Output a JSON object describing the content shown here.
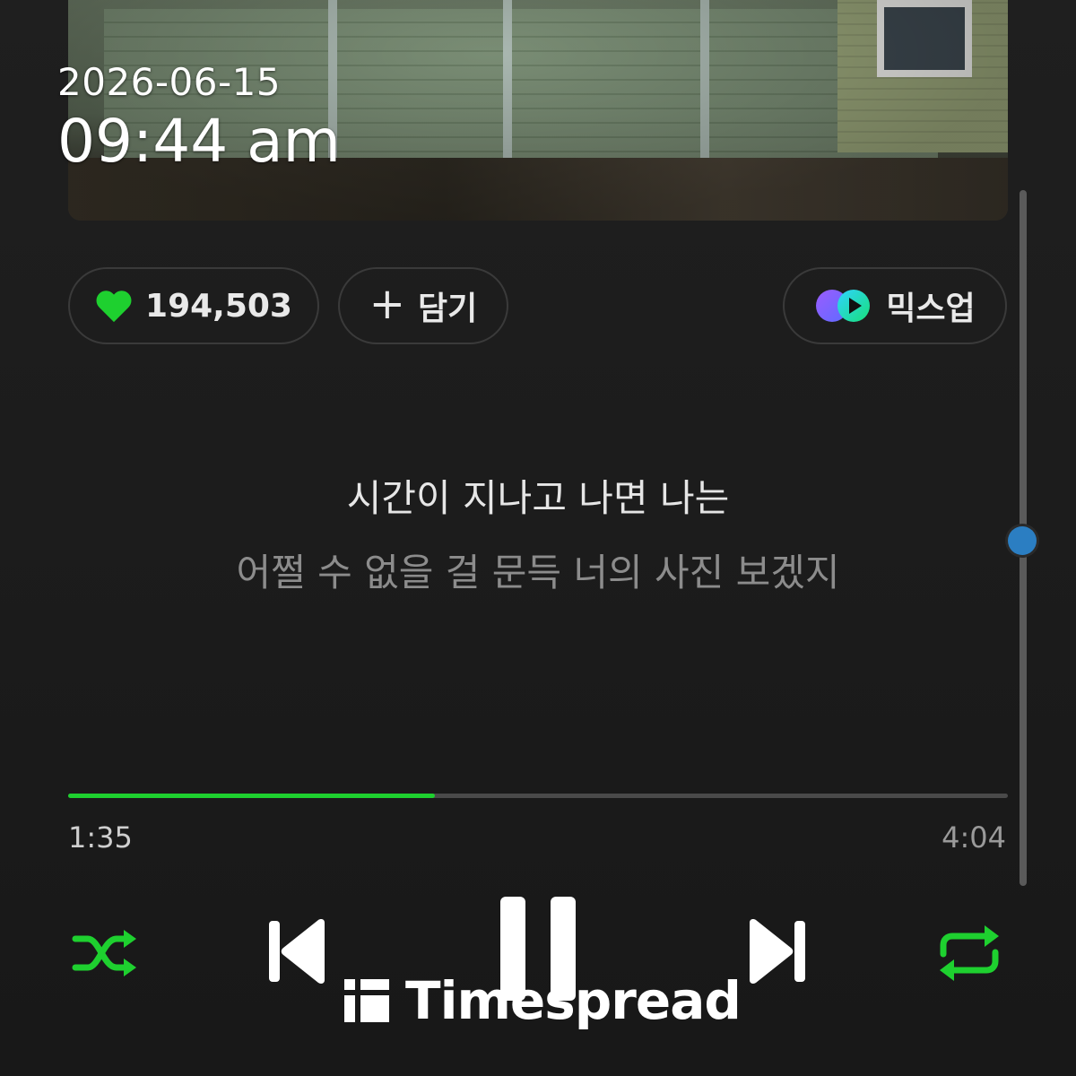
{
  "datetime": {
    "date": "2026-06-15",
    "time": "09:44 am"
  },
  "actions": {
    "like_count": "194,503",
    "add_plus": "+",
    "add_label": "담기",
    "mixup_label": "믹스업"
  },
  "lyrics": {
    "current": "시간이 지나고 나면 나는",
    "next": "어쩔 수 없을 걸 문득 너의 사진 보겠지"
  },
  "playback": {
    "elapsed": "1:35",
    "total": "4:04",
    "progress_fraction": 0.39
  },
  "controls": {
    "shuffle_icon": "shuffle-icon",
    "prev_icon": "skip-previous-icon",
    "pause_icon": "pause-icon",
    "next_icon": "skip-next-icon",
    "repeat_icon": "repeat-icon"
  },
  "colors": {
    "accent_green": "#1ed02f",
    "background": "#1c1c1c",
    "scroll_thumb": "#2b7ec2"
  },
  "watermark": {
    "text": "Timespread"
  }
}
